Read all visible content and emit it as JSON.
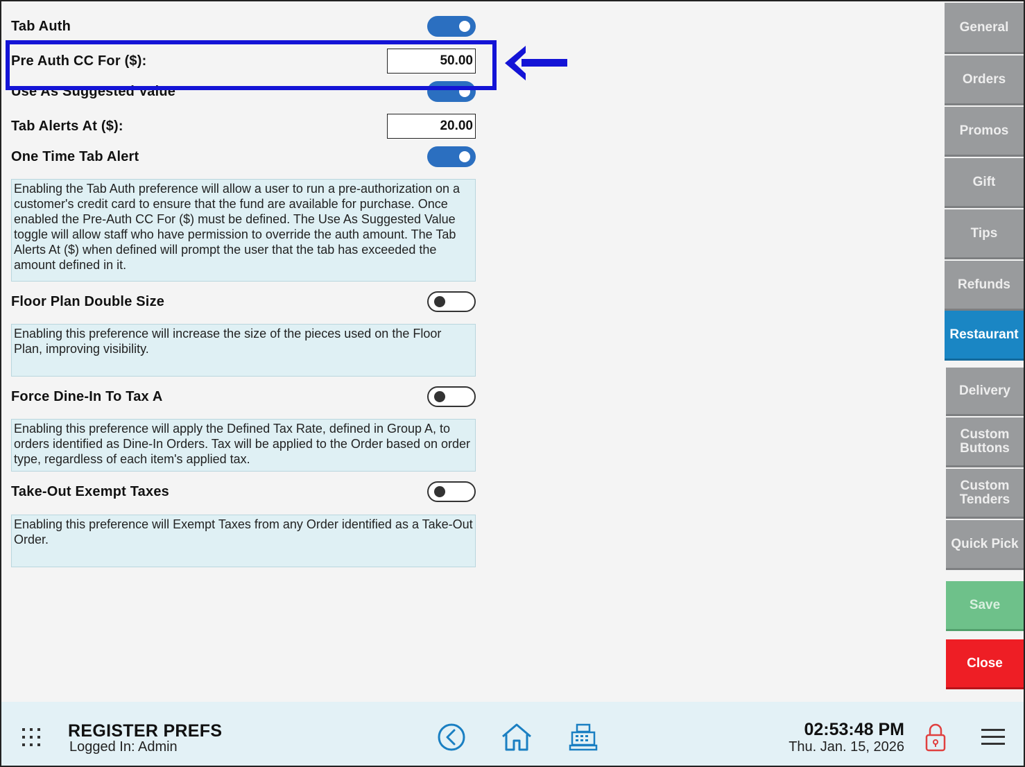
{
  "settings": {
    "tab_auth": {
      "label": "Tab Auth",
      "enabled": true
    },
    "pre_auth": {
      "label": "Pre Auth CC For ($):",
      "value": "50.00"
    },
    "use_suggested": {
      "label": "Use As Suggested Value",
      "enabled": true
    },
    "tab_alerts": {
      "label": "Tab Alerts At ($):",
      "value": "20.00"
    },
    "one_time_alert": {
      "label": "One Time Tab Alert",
      "enabled": true
    },
    "tab_auth_desc": "Enabling the Tab Auth preference will allow a user to run a pre-authorization on a customer's credit card to ensure that the fund are available for purchase. Once enabled the Pre-Auth CC For ($) must be defined. The Use As Suggested Value toggle will allow staff who have permission to override the auth amount. The Tab Alerts At ($) when defined will prompt the user that the tab has exceeded the amount defined in it.",
    "floor_plan": {
      "label": "Floor Plan Double Size",
      "enabled": false,
      "desc": "Enabling this preference will increase the size of the pieces used on the Floor Plan, improving visibility."
    },
    "force_dine_in": {
      "label": "Force Dine-In To Tax A",
      "enabled": false,
      "desc": "Enabling this preference will apply the Defined Tax Rate, defined in Group A, to orders identified as Dine-In Orders. Tax will be applied to the Order based on order type, regardless of each item's applied tax."
    },
    "take_out_exempt": {
      "label": "Take-Out Exempt Taxes",
      "enabled": false,
      "desc": "Enabling this preference will Exempt Taxes from any Order identified as a Take-Out Order."
    }
  },
  "sidebar": {
    "general": "General",
    "orders": "Orders",
    "promos": "Promos",
    "gift": "Gift",
    "tips": "Tips",
    "refunds": "Refunds",
    "restaurant": "Restaurant",
    "delivery": "Delivery",
    "custom_buttons": "Custom Buttons",
    "custom_tenders": "Custom Tenders",
    "quick_pick": "Quick Pick",
    "save": "Save",
    "close": "Close",
    "active": "restaurant"
  },
  "footer": {
    "title": "REGISTER PREFS",
    "logged_in": "Logged In:  Admin",
    "time": "02:53:48 PM",
    "date": "Thu. Jan. 15, 2026"
  },
  "colors": {
    "toggle_on": "#2b6fc0",
    "active_tab": "#1a86c4",
    "save": "#6ec18a",
    "close": "#ee1e25",
    "highlight": "#1414d6",
    "desc_bg": "#dff0f4"
  },
  "icons": [
    "apps-grid-icon",
    "back-icon",
    "home-icon",
    "register-icon",
    "lock-icon",
    "menu-icon",
    "arrow-left-icon"
  ]
}
